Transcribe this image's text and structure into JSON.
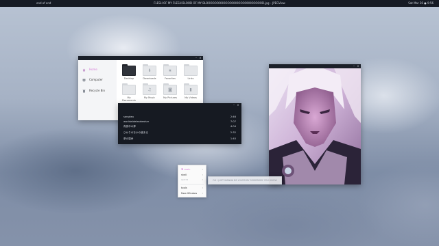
{
  "topbar": {
    "left_text": "end of end",
    "title": "FLESH OF MY FLESH BLOOD OF MY BLOOOOOOOOOOOOOOOOOOOOOOOOOOD.jpg – JPEGView",
    "clock": "Sat Mar 26 ● 9:56"
  },
  "file_manager": {
    "sidebar": [
      {
        "label": "Home",
        "icon": "home-icon",
        "active": true
      },
      {
        "label": "Computer",
        "icon": "computer-icon"
      },
      {
        "label": "Recycle Bin",
        "icon": "trash-icon"
      }
    ],
    "folders": [
      {
        "label": "Desktop",
        "icon": "desktop-folder-icon"
      },
      {
        "label": "Downloads",
        "icon": "downloads-folder-icon"
      },
      {
        "label": "Favorites",
        "icon": "favorites-folder-icon"
      },
      {
        "label": "Links",
        "icon": "links-folder-icon"
      },
      {
        "label": "My Documents",
        "icon": "documents-folder-icon"
      },
      {
        "label": "My Music",
        "icon": "music-folder-icon"
      },
      {
        "label": "My Pictures",
        "icon": "pictures-folder-icon"
      },
      {
        "label": "My Videos",
        "icon": "videos-folder-icon"
      }
    ]
  },
  "player": {
    "tracks": [
      {
        "title": "sangkeu",
        "duration": "2:46"
      },
      {
        "title": "worldwideleadawhar",
        "duration": "7:07"
      },
      {
        "title": "真夜中の夢",
        "duration": "4:04"
      },
      {
        "title": "ひかりのなかの道ある",
        "duration": "2:32"
      },
      {
        "title": "夢の運命",
        "duration": "1:40"
      }
    ]
  },
  "menu": {
    "items": [
      {
        "label": "main",
        "arrow": "›"
      },
      {
        "label": "shell",
        "arrow": "›"
      },
      {
        "label": "opera",
        "arrow": "›",
        "hint": true
      },
      {
        "label": "tools",
        "arrow": "›"
      },
      {
        "label": "New Window",
        "arrow": "›"
      }
    ]
  },
  "tooltip": {
    "text": "OH I JUST WANNA BE LOVED BY SOMEBODY YOU KNOW"
  },
  "colors": {
    "accent": "#d77fd8",
    "panel_dark": "#161a22",
    "titlebar": "#1b2029"
  }
}
